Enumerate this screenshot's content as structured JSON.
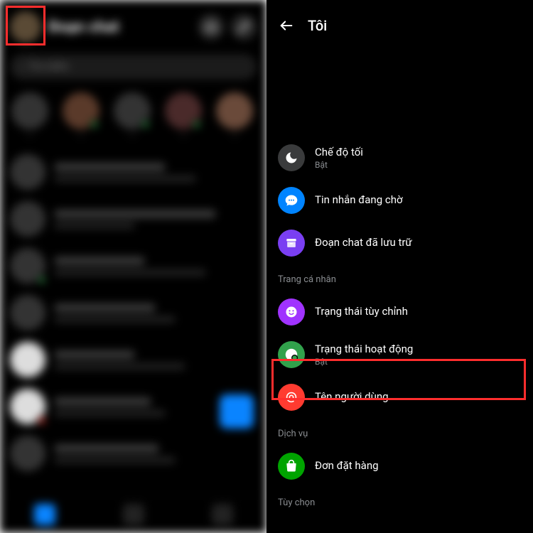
{
  "left": {
    "header_title": "Đoạn chat",
    "search_placeholder": "Tìm kiếm"
  },
  "right": {
    "title": "Tôi",
    "sections": {
      "profile": "Trang cá nhân",
      "service": "Dịch vụ",
      "options": "Tùy chọn"
    },
    "items": {
      "dark_mode": {
        "title": "Chế độ tối",
        "sub": "Bật"
      },
      "message_requests": {
        "title": "Tin nhắn đang chờ"
      },
      "archived": {
        "title": "Đoạn chat đã lưu trữ"
      },
      "custom_status": {
        "title": "Trạng thái tùy chỉnh"
      },
      "active_status": {
        "title": "Trạng thái hoạt động",
        "sub": "Bật"
      },
      "username": {
        "title": "Tên người dùng"
      },
      "orders": {
        "title": "Đơn đặt hàng"
      }
    }
  }
}
